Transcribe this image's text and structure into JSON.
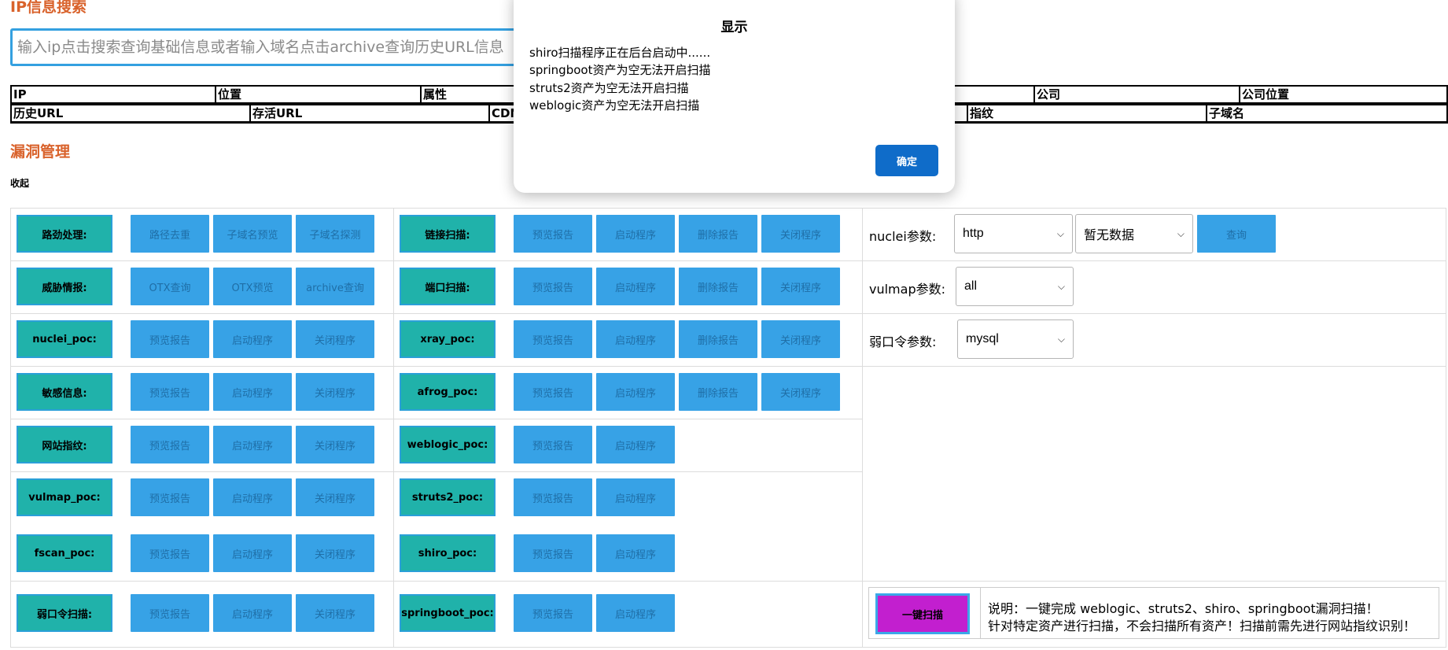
{
  "ip_section": {
    "title": "IP信息搜索",
    "search_placeholder": "输入ip点击搜索查询基础信息或者输入域名点击archive查询历史URL信息"
  },
  "info_table": {
    "row1": [
      "IP",
      "位置",
      "属性",
      "",
      "",
      "公司",
      "公司位置"
    ],
    "row2": [
      "历史URL",
      "存活URL",
      "CDN",
      "",
      "指纹",
      "子域名"
    ]
  },
  "vuln_section": {
    "title": "漏洞管理",
    "collapse_label": "收起"
  },
  "left_rows": [
    {
      "label": "路劲处理:",
      "buttons": [
        "路径去重",
        "子域名预览",
        "子域名探测"
      ]
    },
    {
      "label": "威胁情报:",
      "buttons": [
        "OTX查询",
        "OTX预览",
        "archive查询"
      ]
    },
    {
      "label": "nuclei_poc:",
      "buttons": [
        "预览报告",
        "启动程序",
        "关闭程序"
      ]
    },
    {
      "label": "敏感信息:",
      "buttons": [
        "预览报告",
        "启动程序",
        "关闭程序"
      ]
    },
    {
      "label": "网站指纹:",
      "buttons": [
        "预览报告",
        "启动程序",
        "关闭程序"
      ]
    },
    {
      "label": "vulmap_poc:",
      "buttons": [
        "预览报告",
        "启动程序",
        "关闭程序"
      ]
    },
    {
      "label": "fscan_poc:",
      "buttons": [
        "预览报告",
        "启动程序",
        "关闭程序"
      ]
    },
    {
      "label": "弱口令扫描:",
      "buttons": [
        "预览报告",
        "启动程序",
        "关闭程序"
      ]
    }
  ],
  "middle_rows": [
    {
      "label": "链接扫描:",
      "buttons": [
        "预览报告",
        "启动程序",
        "删除报告",
        "关闭程序"
      ]
    },
    {
      "label": "端口扫描:",
      "buttons": [
        "预览报告",
        "启动程序",
        "删除报告",
        "关闭程序"
      ]
    },
    {
      "label": "xray_poc:",
      "buttons": [
        "预览报告",
        "启动程序",
        "删除报告",
        "关闭程序"
      ]
    },
    {
      "label": "afrog_poc:",
      "buttons": [
        "预览报告",
        "启动程序",
        "删除报告",
        "关闭程序"
      ]
    },
    {
      "label": "weblogic_poc:",
      "buttons": [
        "预览报告",
        "启动程序"
      ]
    },
    {
      "label": "struts2_poc:",
      "buttons": [
        "预览报告",
        "启动程序"
      ]
    },
    {
      "label": "shiro_poc:",
      "buttons": [
        "预览报告",
        "启动程序"
      ]
    },
    {
      "label": "springboot_poc:",
      "buttons": [
        "预览报告",
        "启动程序"
      ]
    }
  ],
  "params": {
    "nuclei_label": "nuclei参数:",
    "nuclei_select1": "http",
    "nuclei_select2": "暂无数据",
    "query_button": "查询",
    "vulmap_label": "vulmap参数:",
    "vulmap_select": "all",
    "weakpass_label": "弱口令参数:",
    "weakpass_select": "mysql"
  },
  "one_click": {
    "button": "一键扫描",
    "note_line1": "说明：一键完成 weblogic、struts2、shiro、springboot漏洞扫描！",
    "note_line2": "针对特定资产进行扫描，不会扫描所有资产！扫描前需先进行网站指纹识别！"
  },
  "dialog": {
    "title": "显示",
    "lines": [
      "shiro扫描程序正在后台启动中......",
      "springboot资产为空无法开启扫描",
      "struts2资产为空无法开启扫描",
      "weblogic资产为空无法开启扫描"
    ],
    "ok_button": "确定"
  },
  "colors": {
    "section_title": "#d9622b",
    "label_button": "#20b2aa",
    "action_button": "#37a2e6",
    "one_click_button": "#c21fcf",
    "dialog_ok": "#0f6cc9"
  }
}
